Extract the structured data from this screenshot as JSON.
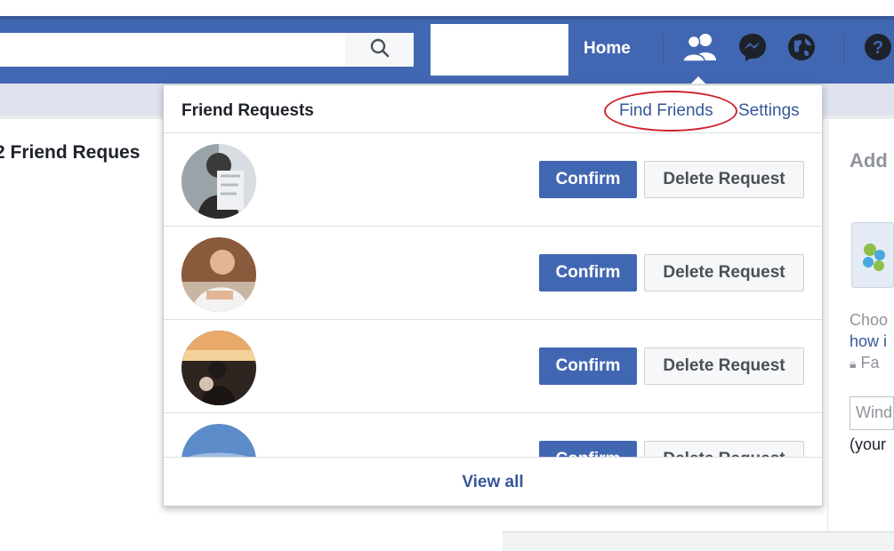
{
  "topbar": {
    "search_placeholder": "",
    "home_label": "Home",
    "icons": [
      "search-icon",
      "friends-icon",
      "messenger-icon",
      "globe-icon",
      "help-icon"
    ],
    "accent_color": "#4267b2"
  },
  "background": {
    "heading": "2 Friend Reques",
    "right_col": {
      "add_text": "Add",
      "line1": "Choo",
      "line2": "how i",
      "line3": "Fa",
      "input_value": "Wind",
      "small_text": "(your"
    }
  },
  "dropdown": {
    "title": "Friend Requests",
    "find_friends_label": "Find Friends",
    "settings_label": "Settings",
    "requests": [
      {
        "confirm_label": "Confirm",
        "delete_label": "Delete Request"
      },
      {
        "confirm_label": "Confirm",
        "delete_label": "Delete Request"
      },
      {
        "confirm_label": "Confirm",
        "delete_label": "Delete Request"
      },
      {
        "confirm_label": "Confirm",
        "delete_label": "Delete Request"
      }
    ],
    "view_all_label": "View all",
    "highlight_color": "#d0212b"
  }
}
